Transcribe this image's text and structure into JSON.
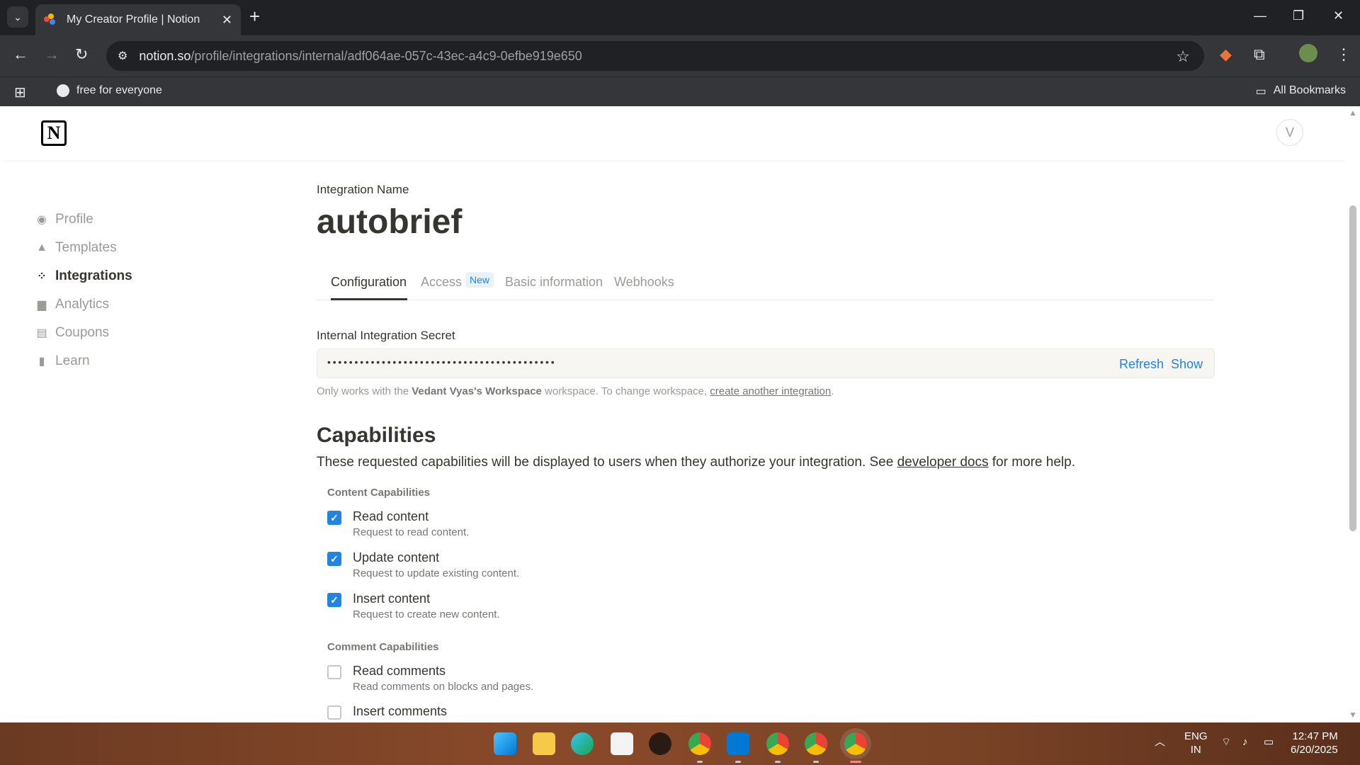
{
  "browser": {
    "tab_title": "My Creator Profile | Notion",
    "url_host": "notion.so",
    "url_path": "/profile/integrations/internal/adf064ae-057c-43ec-a4c9-0efbe919e650",
    "bookmark": "free for everyone",
    "all_bookmarks": "All Bookmarks"
  },
  "notion": {
    "avatar_initial": "V"
  },
  "sidebar": {
    "items": [
      {
        "label": "Profile",
        "icon": "profile-icon",
        "active": false
      },
      {
        "label": "Templates",
        "icon": "templates-icon",
        "active": false
      },
      {
        "label": "Integrations",
        "icon": "integrations-icon",
        "active": true
      },
      {
        "label": "Analytics",
        "icon": "analytics-icon",
        "active": false
      },
      {
        "label": "Coupons",
        "icon": "coupons-icon",
        "active": false
      },
      {
        "label": "Learn",
        "icon": "learn-icon",
        "active": false
      }
    ]
  },
  "integration": {
    "name_label": "Integration Name",
    "name": "autobrief",
    "tabs": [
      {
        "label": "Configuration",
        "active": true
      },
      {
        "label": "Access",
        "active": false
      },
      {
        "label": "Basic information",
        "active": false
      },
      {
        "label": "Webhooks",
        "active": false
      }
    ],
    "access_badge": "New",
    "secret_label": "Internal Integration Secret",
    "secret_masked": "••••••••••••••••••••••••••••••••••••••••••",
    "refresh_label": "Refresh",
    "show_label": "Show",
    "note_prefix": "Only works with the ",
    "note_workspace": "Vedant Vyas's Workspace",
    "note_middle": " workspace. To change workspace, ",
    "note_link": "create another integration",
    "note_suffix": "."
  },
  "capabilities": {
    "title": "Capabilities",
    "desc_prefix": "These requested capabilities will be displayed to users when they authorize your integration. See ",
    "desc_link": "developer docs",
    "desc_suffix": " for more help.",
    "content_label": "Content Capabilities",
    "content": [
      {
        "name": "Read content",
        "desc": "Request to read content.",
        "checked": true
      },
      {
        "name": "Update content",
        "desc": "Request to update existing content.",
        "checked": true
      },
      {
        "name": "Insert content",
        "desc": "Request to create new content.",
        "checked": true
      }
    ],
    "comment_label": "Comment Capabilities",
    "comment": [
      {
        "name": "Read comments",
        "desc": "Read comments on blocks and pages.",
        "checked": false
      },
      {
        "name": "Insert comments",
        "desc": "",
        "checked": false
      }
    ]
  },
  "taskbar": {
    "lang_top": "ENG",
    "lang_bottom": "IN",
    "time": "12:47 PM",
    "date": "6/20/2025"
  },
  "colors": {
    "accent": "#2383e2",
    "text": "#37352f",
    "muted": "#9b9a97"
  }
}
